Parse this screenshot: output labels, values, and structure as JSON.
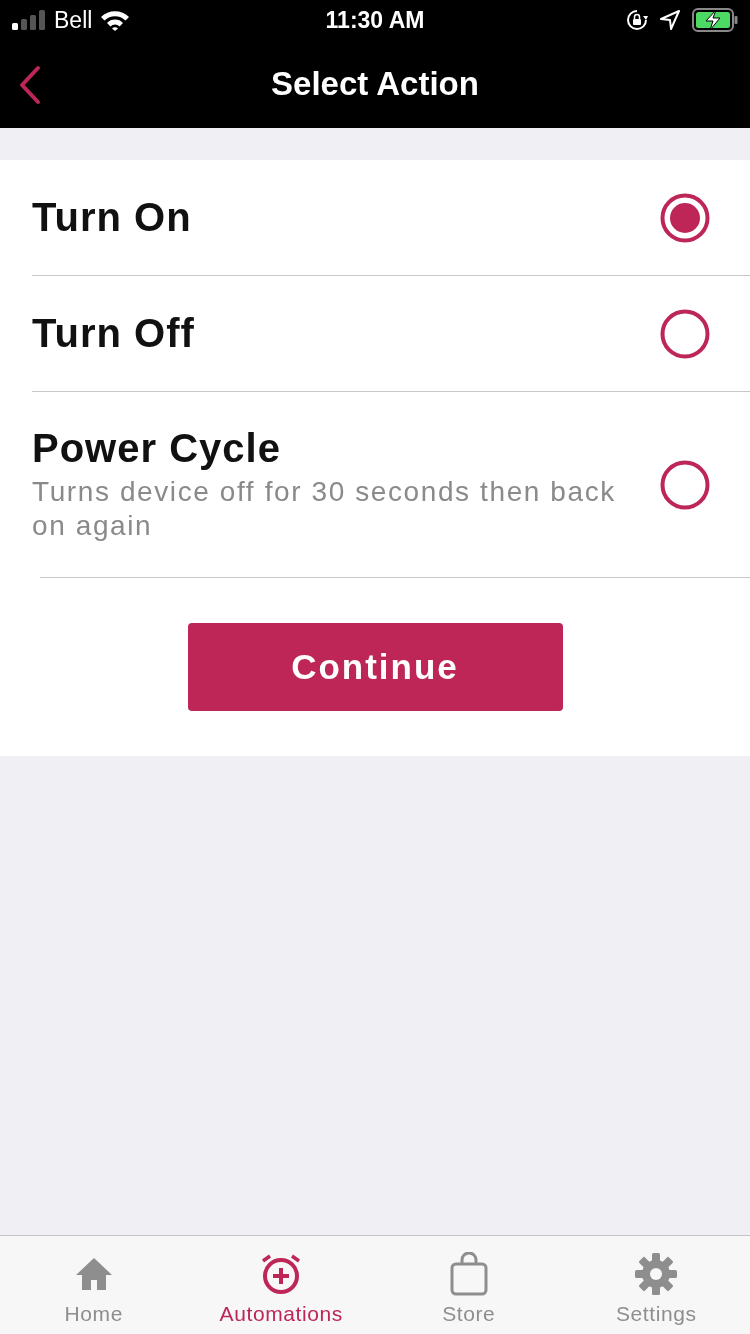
{
  "status_bar": {
    "carrier": "Bell",
    "time": "11:30 AM"
  },
  "nav_bar": {
    "title": "Select Action"
  },
  "options": [
    {
      "label": "Turn On",
      "selected": true
    },
    {
      "label": "Turn Off",
      "selected": false
    },
    {
      "label": "Power Cycle",
      "description": "Turns device off for 30 seconds then back on again",
      "selected": false
    }
  ],
  "button": {
    "label": "Continue"
  },
  "tab_bar": [
    {
      "kind": "home",
      "label": "Home",
      "selected": false
    },
    {
      "kind": "automations",
      "label": "Automations",
      "selected": true
    },
    {
      "kind": "store",
      "label": "Store",
      "selected": false
    },
    {
      "kind": "settings",
      "label": "Settings",
      "selected": false
    }
  ]
}
